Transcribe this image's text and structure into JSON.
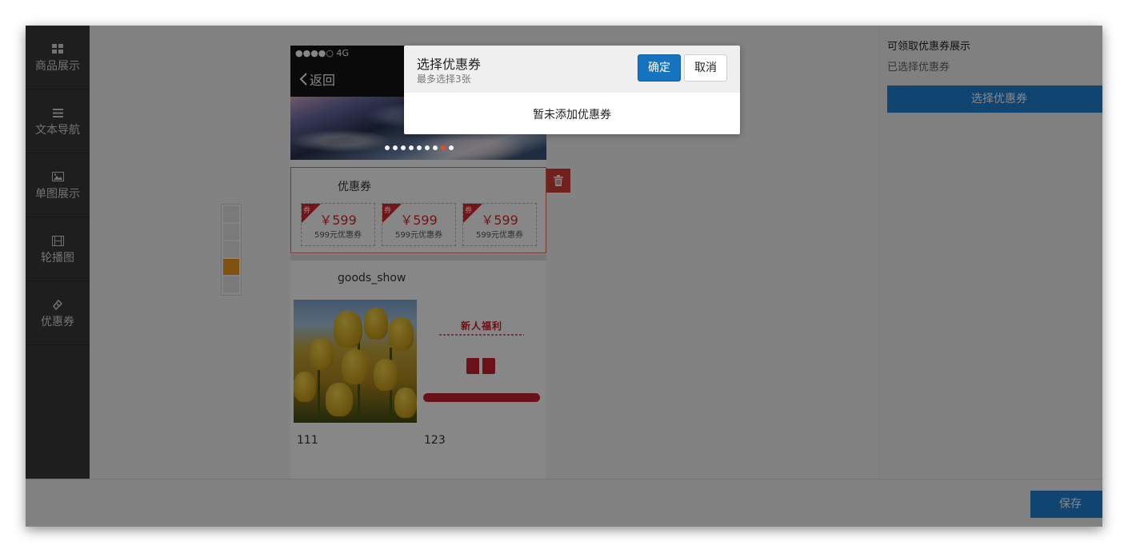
{
  "sidebar": {
    "items": [
      {
        "label": "商品展示",
        "icon": "grid-icon"
      },
      {
        "label": "文本导航",
        "icon": "menu-lines-icon"
      },
      {
        "label": "单图展示",
        "icon": "image-icon"
      },
      {
        "label": "轮播图",
        "icon": "film-icon"
      },
      {
        "label": "优惠券",
        "icon": "ticket-icon"
      }
    ]
  },
  "phone": {
    "status": "●●●●○ 4G",
    "back_label": "返回",
    "coupon_section": {
      "title": "优惠券",
      "tag": "券",
      "coupons": [
        {
          "price": "￥599",
          "desc": "599元优惠券"
        },
        {
          "price": "￥599",
          "desc": "599元优惠券"
        },
        {
          "price": "￥599",
          "desc": "599元优惠券"
        }
      ]
    },
    "goods_section": {
      "title": "goods_show",
      "items": [
        {
          "name": "111"
        },
        {
          "name": "123",
          "promo_title": "新人福利"
        }
      ]
    }
  },
  "right_panel": {
    "title": "可领取优惠券展示",
    "subtitle": "已选择优惠券",
    "button_label": "选择优惠券"
  },
  "footer": {
    "save_label": "保存"
  },
  "modal": {
    "title": "选择优惠券",
    "subtitle": "最多选择3张",
    "confirm_label": "确定",
    "cancel_label": "取消",
    "empty_text": "暂未添加优惠券"
  },
  "colors": {
    "primary": "#1673bf",
    "sidebar": "#3a3a3a",
    "coupon_red": "#d9292b",
    "delete_red": "#d33f37",
    "floor_active": "#f39a1c"
  }
}
